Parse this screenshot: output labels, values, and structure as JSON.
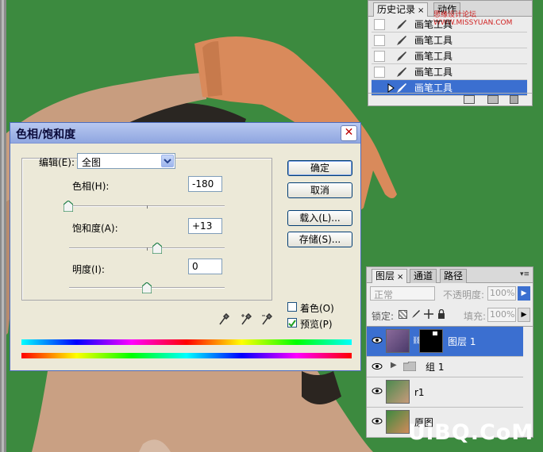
{
  "history_panel": {
    "tabs": [
      {
        "label": "历史记录",
        "close": "×"
      },
      {
        "label": "动作"
      }
    ],
    "watermark": "思缘设计论坛 WWW.MISSYUAN.COM",
    "items": [
      {
        "label": "画笔工具"
      },
      {
        "label": "画笔工具"
      },
      {
        "label": "画笔工具"
      },
      {
        "label": "画笔工具"
      },
      {
        "label": "画笔工具",
        "selected": true
      }
    ]
  },
  "layers_panel": {
    "tabs": [
      {
        "label": "图层",
        "close": "×"
      },
      {
        "label": "通道"
      },
      {
        "label": "路径"
      }
    ],
    "blend_mode": "正常",
    "opacity_label": "不透明度:",
    "opacity_value": "100%",
    "lock_label": "锁定:",
    "fill_label": "填充:",
    "fill_value": "100%",
    "layers": [
      {
        "name": "图层 1",
        "selected": true
      },
      {
        "name": "组 1",
        "type": "group"
      },
      {
        "name": "r1"
      },
      {
        "name": "原图"
      }
    ]
  },
  "dialog": {
    "title": "色相/饱和度",
    "close": "✕",
    "edit_label": "编辑(E):",
    "edit_value": "全图",
    "hue_label": "色相(H):",
    "hue_value": "-180",
    "saturation_label": "饱和度(A):",
    "saturation_value": "+13",
    "lightness_label": "明度(I):",
    "lightness_value": "0",
    "buttons": {
      "ok": "确定",
      "cancel": "取消",
      "load": "载入(L)...",
      "save": "存储(S)..."
    },
    "colorize_label": "着色(O)",
    "colorize_checked": false,
    "preview_label": "预览(P)",
    "preview_checked": true
  },
  "watermark": "UiBQ.CoM",
  "colors": {
    "background": "#3c8a3f",
    "selection": "#3b6fd0",
    "dialog_face": "#ece9d8"
  }
}
